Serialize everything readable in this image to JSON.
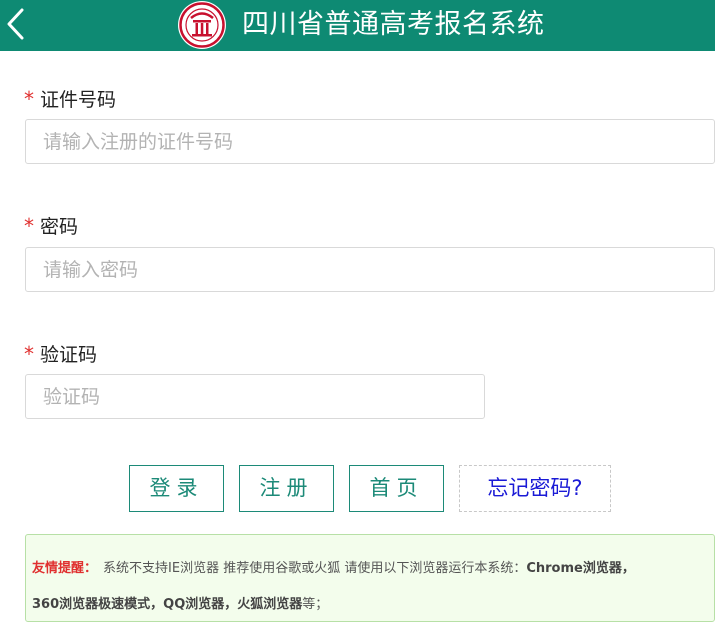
{
  "header": {
    "title": "四川省普通高考报名系统",
    "back_icon": "chevron-left-icon",
    "logo_icon": "emblem-logo-icon",
    "bg_color": "#0e8a73"
  },
  "form": {
    "required_mark": "*",
    "id_number": {
      "label": "证件号码",
      "placeholder": "请输入注册的证件号码",
      "value": ""
    },
    "password": {
      "label": "密码",
      "placeholder": "请输入密码",
      "value": ""
    },
    "captcha": {
      "label": "验证码",
      "placeholder": "验证码",
      "value": ""
    }
  },
  "actions": {
    "login": "登录",
    "register": "注册",
    "home": "首页",
    "forgot": "忘记密码?"
  },
  "notice": {
    "title": "友情提醒：",
    "line1": "系统不支持IE浏览器 推荐使用谷歌或火狐 请使用以下浏览器运行本系统：",
    "browser1": "Chrome浏览器，",
    "browser2": "360浏览器极速模式，QQ浏览器，火狐浏览器",
    "ending": "等；"
  },
  "colors": {
    "accent": "#0e8a73",
    "button_text": "#1c8a78",
    "required": "#e0302f",
    "link": "#1a1ad6",
    "notice_bg": "#f3fdec"
  }
}
